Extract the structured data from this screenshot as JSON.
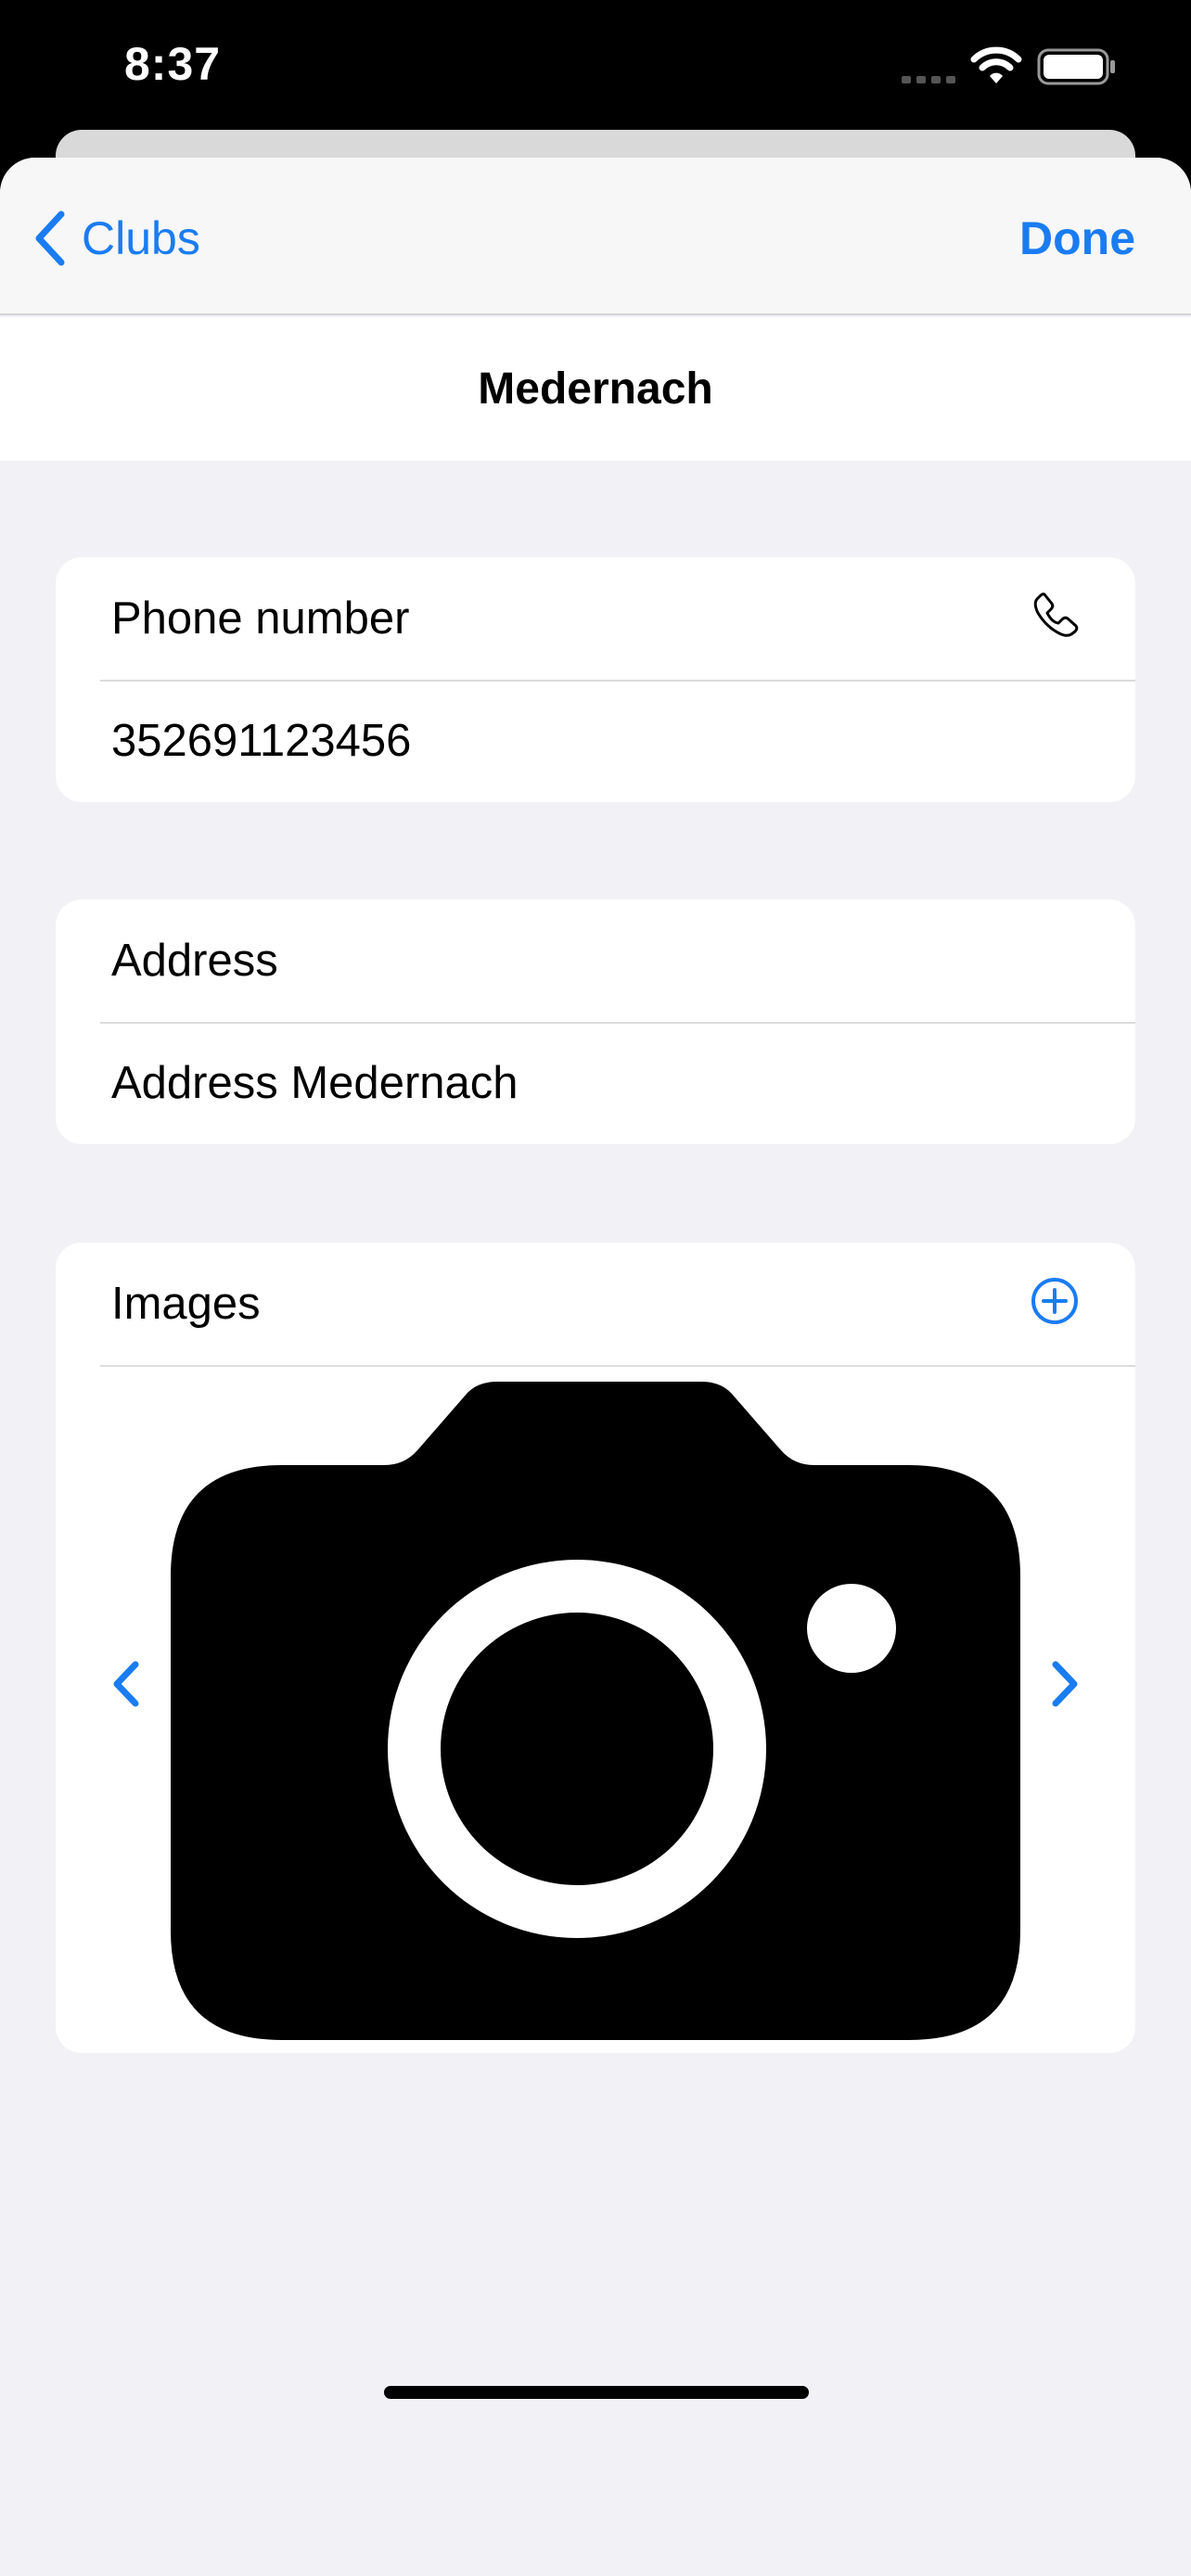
{
  "status_bar": {
    "time": "8:37"
  },
  "nav": {
    "back_label": "Clubs",
    "done_label": "Done"
  },
  "title": "Medernach",
  "phone": {
    "label": "Phone number",
    "value": "352691123456"
  },
  "address": {
    "label": "Address",
    "value": "Address Medernach"
  },
  "images": {
    "label": "Images"
  },
  "icons": {
    "back": "chevron-left-icon",
    "phone": "phone-icon",
    "add": "plus-circle-icon",
    "image": "camera-icon",
    "prev": "chevron-left-icon",
    "next": "chevron-right-icon"
  },
  "colors": {
    "accent": "#1a7cf2",
    "background": "#f1f1f6",
    "card": "#ffffff"
  }
}
